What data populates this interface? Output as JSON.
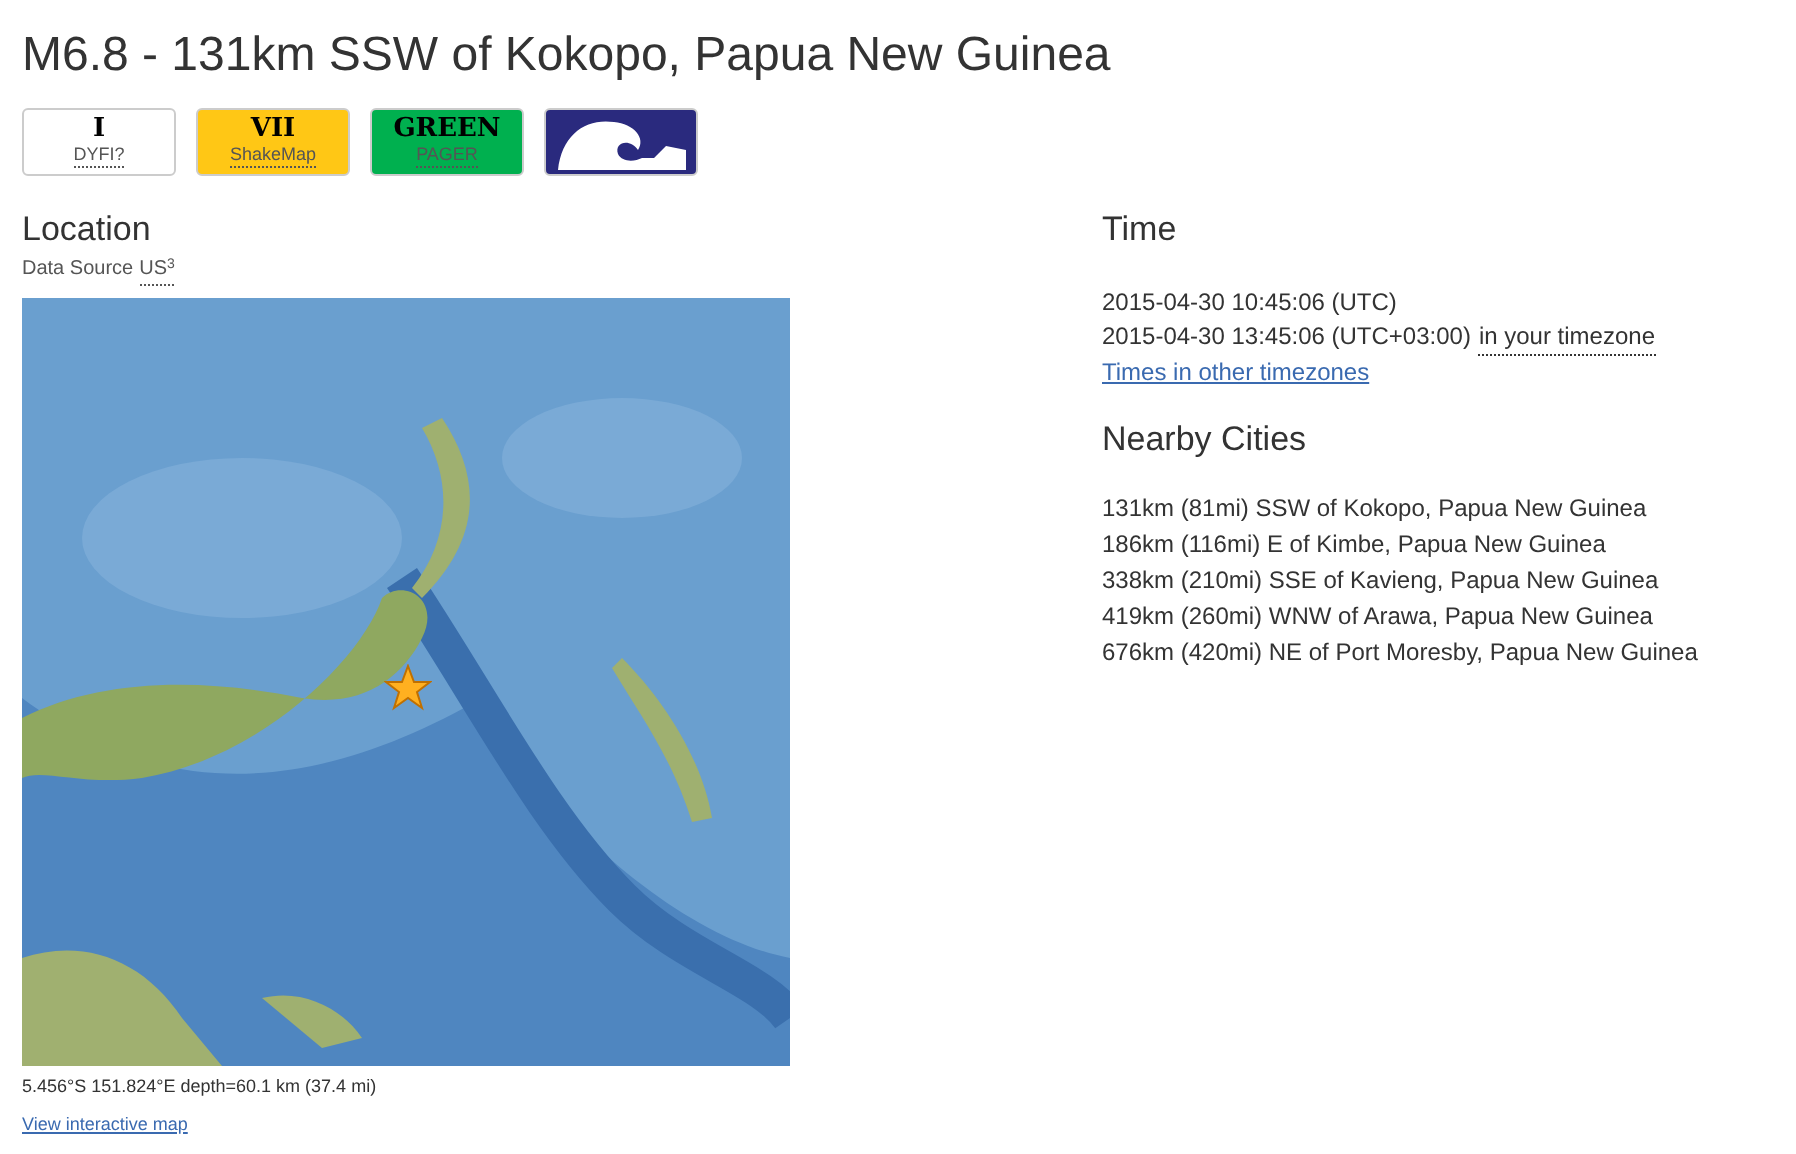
{
  "title": "M6.8 - 131km SSW of Kokopo, Papua New Guinea",
  "badges": [
    {
      "kind": "text",
      "value": "I",
      "label": "DYFI?",
      "color": "#ffffff"
    },
    {
      "kind": "text",
      "value": "VII",
      "label": "ShakeMap",
      "color": "#ffc715"
    },
    {
      "kind": "text",
      "value": "GREEN",
      "label": "PAGER",
      "color": "#00b04f"
    },
    {
      "kind": "icon",
      "color": "#2a2a7e"
    }
  ],
  "location": {
    "heading": "Location",
    "source_label": "Data Source",
    "source_link": "US",
    "source_mark": "3",
    "coordinates": "5.456°S 151.824°E depth=60.1 km (37.4 mi)",
    "map_link": "View interactive map"
  },
  "time": {
    "heading": "Time",
    "utc": "2015-04-30 10:45:06 (UTC)",
    "local": "2015-04-30 13:45:06 (UTC+03:00)",
    "local_note": "in your timezone",
    "link": "Times in other timezones"
  },
  "nearby": {
    "heading": "Nearby Cities",
    "cities": [
      "131km (81mi) SSW of Kokopo, Papua New Guinea",
      "186km (116mi) E of Kimbe, Papua New Guinea",
      "338km (210mi) SSE of Kavieng, Papua New Guinea",
      "419km (260mi) WNW of Arawa, Papua New Guinea",
      "676km (420mi) NE of Port Moresby, Papua New Guinea"
    ]
  }
}
